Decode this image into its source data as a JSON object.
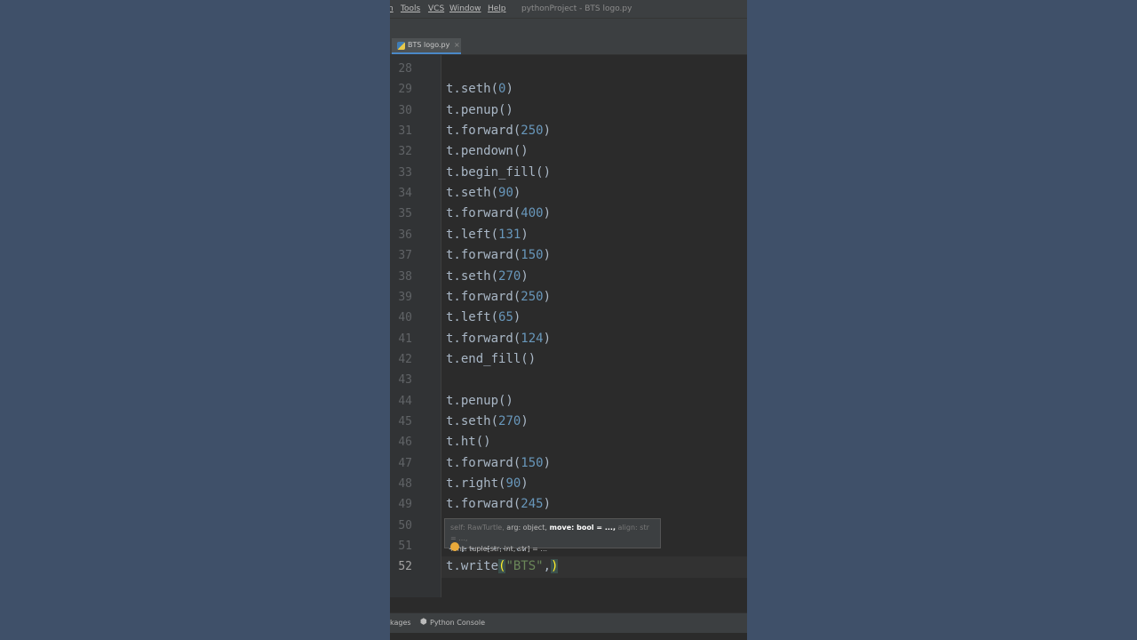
{
  "menubar": {
    "items": [
      {
        "label": "n"
      },
      {
        "label": "Tools"
      },
      {
        "label": "VCS"
      },
      {
        "label": "Window"
      },
      {
        "label": "Help"
      }
    ],
    "window_title": "pythonProject - BTS logo.py"
  },
  "editor_tab": {
    "label": "BTS logo.py",
    "close": "×",
    "icon": "python-file-icon"
  },
  "lines": [
    {
      "n": "28",
      "code": ""
    },
    {
      "n": "29",
      "code": "t.seth(0)"
    },
    {
      "n": "30",
      "code": "t.penup()"
    },
    {
      "n": "31",
      "code": "t.forward(250)"
    },
    {
      "n": "32",
      "code": "t.pendown()"
    },
    {
      "n": "33",
      "code": "t.begin_fill()"
    },
    {
      "n": "34",
      "code": "t.seth(90)"
    },
    {
      "n": "35",
      "code": "t.forward(400)"
    },
    {
      "n": "36",
      "code": "t.left(131)"
    },
    {
      "n": "37",
      "code": "t.forward(150)"
    },
    {
      "n": "38",
      "code": "t.seth(270)"
    },
    {
      "n": "39",
      "code": "t.forward(250)"
    },
    {
      "n": "40",
      "code": "t.left(65)"
    },
    {
      "n": "41",
      "code": "t.forward(124)"
    },
    {
      "n": "42",
      "code": "t.end_fill()"
    },
    {
      "n": "43",
      "code": ""
    },
    {
      "n": "44",
      "code": "t.penup()"
    },
    {
      "n": "45",
      "code": "t.seth(270)"
    },
    {
      "n": "46",
      "code": "t.ht()"
    },
    {
      "n": "47",
      "code": "t.forward(150)"
    },
    {
      "n": "48",
      "code": "t.right(90)"
    },
    {
      "n": "49",
      "code": "t.forward(245)"
    },
    {
      "n": "50",
      "code": ""
    },
    {
      "n": "51",
      "code": "t.pendown()"
    },
    {
      "n": "52",
      "code": "t.write(\"BTS\",)"
    }
  ],
  "current_line": "52",
  "param_hint": {
    "part1": "self: RawTurtle,",
    "part2": " arg: object,",
    "part3": " move: bool = ...,",
    "part4": " align: str = ...,",
    "line2": "font: tuple[str, int, str] = ..."
  },
  "statusbar": {
    "left": "kages",
    "python_console": "Python Console",
    "icon": "python-console-icon"
  },
  "colors": {
    "keyword_number": "#6897bb",
    "string": "#6a8759",
    "default_text": "#a9b7c6",
    "background": "#2b2b2b"
  }
}
